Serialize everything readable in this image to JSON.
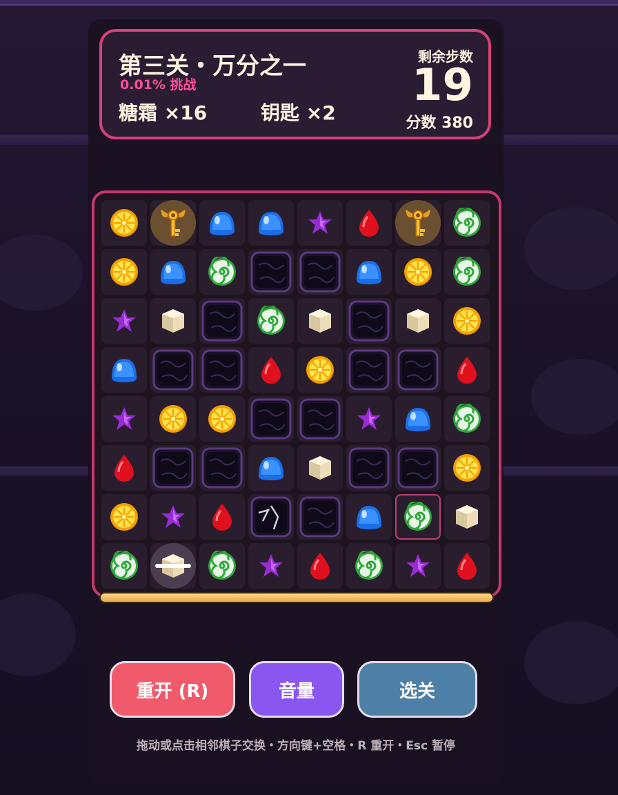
{
  "hud": {
    "title": "第三关・万分之一",
    "subtitle": "0.01% 挑战",
    "goals": {
      "frost": "糖霜 ×16",
      "key": "钥匙 ×2"
    },
    "moves_label": "剩余步数",
    "moves_value": "19",
    "score": "分数 380"
  },
  "board": {
    "rows": 8,
    "cols": 8,
    "selected": [
      6,
      6
    ],
    "grid": [
      [
        "orange",
        "key",
        "blue",
        "blue",
        "star",
        "red",
        "key",
        "green"
      ],
      [
        "orange",
        "blue",
        "green",
        "jelly",
        "jelly",
        "blue",
        "orange",
        "green"
      ],
      [
        "star",
        "cube",
        "jelly",
        "green",
        "cube",
        "jelly",
        "cube",
        "orange"
      ],
      [
        "blue",
        "jelly",
        "jelly",
        "red",
        "orange",
        "jelly",
        "jelly",
        "red"
      ],
      [
        "star",
        "orange",
        "orange",
        "jelly",
        "jelly",
        "star",
        "blue",
        "green"
      ],
      [
        "red",
        "jelly",
        "jelly",
        "blue",
        "cube",
        "jelly",
        "jelly",
        "orange"
      ],
      [
        "orange",
        "star",
        "red",
        "cracked",
        "jelly",
        "blue",
        "green",
        "cube"
      ],
      [
        "green",
        "striped-cube",
        "green",
        "star",
        "red",
        "green",
        "star",
        "red"
      ]
    ]
  },
  "progress": 1.0,
  "buttons": {
    "restart": "重开 (R)",
    "volume": "音量",
    "levels": "选关"
  },
  "help": "拖动或点击相邻棋子交换・方向键+空格・R 重开・Esc 暂停",
  "colors": {
    "accent": "#d9407a",
    "restart": "#f05a6a",
    "volume": "#8a56f0",
    "levels": "#4e7fa6"
  }
}
